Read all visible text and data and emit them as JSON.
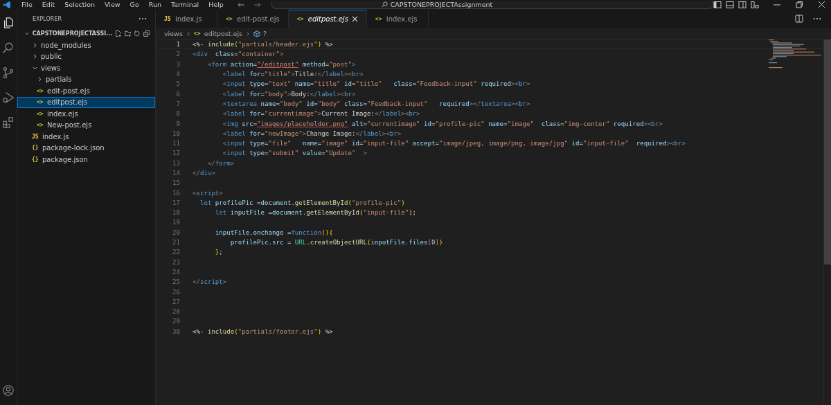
{
  "title_bar": {
    "menu": [
      "File",
      "Edit",
      "Selection",
      "View",
      "Go",
      "Run",
      "Terminal",
      "Help"
    ],
    "search_title": "CAPSTONEPROJECTAssignment"
  },
  "sidebar": {
    "title": "EXPLORER",
    "project": {
      "name": "CAPSTONEPROJECTASSI...",
      "expanded": true
    },
    "tree": [
      {
        "label": "node_modules",
        "kind": "folder",
        "expanded": false,
        "selected": false
      },
      {
        "label": "public",
        "kind": "folder",
        "expanded": false,
        "selected": false
      },
      {
        "label": "views",
        "kind": "folder",
        "expanded": true,
        "selected": false,
        "children": [
          {
            "label": "partials",
            "kind": "folder",
            "expanded": false,
            "selected": false
          },
          {
            "label": "edit-post.ejs",
            "kind": "ejs",
            "icon": "<>",
            "selected": false
          },
          {
            "label": "editpost.ejs",
            "kind": "ejs",
            "icon": "<>",
            "selected": true
          },
          {
            "label": "index.ejs",
            "kind": "ejs",
            "icon": "<>",
            "selected": false
          },
          {
            "label": "New-post.ejs",
            "kind": "ejs",
            "icon": "<>",
            "selected": false
          }
        ]
      },
      {
        "label": "index.js",
        "kind": "js",
        "icon": "JS",
        "selected": false
      },
      {
        "label": "package-lock.json",
        "kind": "json",
        "icon": "{}",
        "selected": false
      },
      {
        "label": "package.json",
        "kind": "json",
        "icon": "{}",
        "selected": false
      }
    ]
  },
  "tabs": [
    {
      "label": "index.js",
      "kind": "js",
      "icon": "JS",
      "selected": false
    },
    {
      "label": "edit-post.ejs",
      "kind": "ejs",
      "icon": "<>",
      "selected": false
    },
    {
      "label": "editpost.ejs",
      "kind": "ejs",
      "icon": "<>",
      "selected": true
    },
    {
      "label": "index.ejs",
      "kind": "ejs",
      "icon": "<>",
      "selected": false
    }
  ],
  "breadcrumb": {
    "parts": [
      "views",
      "editpost.ejs"
    ],
    "symbol": "?"
  },
  "editor": {
    "lines": [
      {
        "number": "1",
        "current": true,
        "tokens": [
          {
            "text": "<%- ",
            "kind": "ejs"
          },
          {
            "text": "include",
            "kind": "fn"
          },
          {
            "text": "(",
            "kind": "paren"
          },
          {
            "text": "\"partials/header.ejs\"",
            "kind": "str"
          },
          {
            "text": ")",
            "kind": "paren"
          },
          {
            "text": " %>",
            "kind": "ejs"
          }
        ]
      },
      {
        "number": "2",
        "current": false,
        "tokens": [
          {
            "text": "<",
            "kind": "br"
          },
          {
            "text": "div",
            "kind": "tag"
          },
          {
            "text": "  class",
            "kind": "attr"
          },
          {
            "text": "=",
            "kind": "text"
          },
          {
            "text": "\"container\"",
            "kind": "str"
          },
          {
            "text": ">",
            "kind": "br"
          }
        ]
      },
      {
        "number": "3",
        "current": false,
        "tokens": [
          {
            "text": "    <",
            "kind": "br"
          },
          {
            "text": "form",
            "kind": "tag"
          },
          {
            "text": " action",
            "kind": "attr"
          },
          {
            "text": "=",
            "kind": "text"
          },
          {
            "text": "\"/editpost\"",
            "kind": "link"
          },
          {
            "text": " method",
            "kind": "attr"
          },
          {
            "text": "=",
            "kind": "text"
          },
          {
            "text": "\"post\"",
            "kind": "str"
          },
          {
            "text": ">",
            "kind": "br"
          }
        ]
      },
      {
        "number": "4",
        "current": false,
        "tokens": [
          {
            "text": "        <",
            "kind": "br"
          },
          {
            "text": "label",
            "kind": "tag"
          },
          {
            "text": " for",
            "kind": "attr"
          },
          {
            "text": "=",
            "kind": "text"
          },
          {
            "text": "\"title\"",
            "kind": "str"
          },
          {
            "text": ">",
            "kind": "br"
          },
          {
            "text": "Title:",
            "kind": "text"
          },
          {
            "text": "</",
            "kind": "br"
          },
          {
            "text": "label",
            "kind": "tag"
          },
          {
            "text": "><",
            "kind": "br"
          },
          {
            "text": "br",
            "kind": "tag"
          },
          {
            "text": ">",
            "kind": "br"
          }
        ]
      },
      {
        "number": "5",
        "current": false,
        "tokens": [
          {
            "text": "        <",
            "kind": "br"
          },
          {
            "text": "input",
            "kind": "tag"
          },
          {
            "text": " type",
            "kind": "attr"
          },
          {
            "text": "=",
            "kind": "text"
          },
          {
            "text": "\"text\"",
            "kind": "str"
          },
          {
            "text": " name",
            "kind": "attr"
          },
          {
            "text": "=",
            "kind": "text"
          },
          {
            "text": "\"title\"",
            "kind": "str"
          },
          {
            "text": " id",
            "kind": "attr"
          },
          {
            "text": "=",
            "kind": "text"
          },
          {
            "text": "\"title\"",
            "kind": "str"
          },
          {
            "text": "   class",
            "kind": "attr"
          },
          {
            "text": "=",
            "kind": "text"
          },
          {
            "text": "\"Feedback-input\"",
            "kind": "str"
          },
          {
            "text": " required",
            "kind": "attr"
          },
          {
            "text": "><",
            "kind": "br"
          },
          {
            "text": "br",
            "kind": "tag"
          },
          {
            "text": ">",
            "kind": "br"
          }
        ]
      },
      {
        "number": "6",
        "current": false,
        "tokens": [
          {
            "text": "        <",
            "kind": "br"
          },
          {
            "text": "label",
            "kind": "tag"
          },
          {
            "text": " for",
            "kind": "attr"
          },
          {
            "text": "=",
            "kind": "text"
          },
          {
            "text": "\"body\"",
            "kind": "str"
          },
          {
            "text": ">",
            "kind": "br"
          },
          {
            "text": "Body:",
            "kind": "text"
          },
          {
            "text": "</",
            "kind": "br"
          },
          {
            "text": "label",
            "kind": "tag"
          },
          {
            "text": "><",
            "kind": "br"
          },
          {
            "text": "br",
            "kind": "tag"
          },
          {
            "text": ">",
            "kind": "br"
          }
        ]
      },
      {
        "number": "7",
        "current": false,
        "tokens": [
          {
            "text": "        <",
            "kind": "br"
          },
          {
            "text": "textarea",
            "kind": "tag"
          },
          {
            "text": " name",
            "kind": "attr"
          },
          {
            "text": "=",
            "kind": "text"
          },
          {
            "text": "\"body\"",
            "kind": "str"
          },
          {
            "text": " id",
            "kind": "attr"
          },
          {
            "text": "=",
            "kind": "text"
          },
          {
            "text": "\"body\"",
            "kind": "str"
          },
          {
            "text": " class",
            "kind": "attr"
          },
          {
            "text": "=",
            "kind": "text"
          },
          {
            "text": "\"Feedback-input\"",
            "kind": "str"
          },
          {
            "text": "   required",
            "kind": "attr"
          },
          {
            "text": "></",
            "kind": "br"
          },
          {
            "text": "textarea",
            "kind": "tag"
          },
          {
            "text": "><",
            "kind": "br"
          },
          {
            "text": "br",
            "kind": "tag"
          },
          {
            "text": ">",
            "kind": "br"
          }
        ]
      },
      {
        "number": "8",
        "current": false,
        "tokens": [
          {
            "text": "        <",
            "kind": "br"
          },
          {
            "text": "label",
            "kind": "tag"
          },
          {
            "text": " for",
            "kind": "attr"
          },
          {
            "text": "=",
            "kind": "text"
          },
          {
            "text": "\"currentimage\"",
            "kind": "str"
          },
          {
            "text": ">",
            "kind": "br"
          },
          {
            "text": "Current Image:",
            "kind": "text"
          },
          {
            "text": "</",
            "kind": "br"
          },
          {
            "text": "label",
            "kind": "tag"
          },
          {
            "text": "><",
            "kind": "br"
          },
          {
            "text": "br",
            "kind": "tag"
          },
          {
            "text": ">",
            "kind": "br"
          }
        ]
      },
      {
        "number": "9",
        "current": false,
        "tokens": [
          {
            "text": "        <",
            "kind": "br"
          },
          {
            "text": "img",
            "kind": "tag"
          },
          {
            "text": " src",
            "kind": "attr"
          },
          {
            "text": "=",
            "kind": "text"
          },
          {
            "text": "\"images/placeholder.png\"",
            "kind": "link"
          },
          {
            "text": " alt",
            "kind": "attr"
          },
          {
            "text": "=",
            "kind": "text"
          },
          {
            "text": "\"currentimage\"",
            "kind": "str"
          },
          {
            "text": " id",
            "kind": "attr"
          },
          {
            "text": "=",
            "kind": "text"
          },
          {
            "text": "\"profile-pic\"",
            "kind": "str"
          },
          {
            "text": " name",
            "kind": "attr"
          },
          {
            "text": "=",
            "kind": "text"
          },
          {
            "text": "\"image\"",
            "kind": "str"
          },
          {
            "text": "  class",
            "kind": "attr"
          },
          {
            "text": "=",
            "kind": "text"
          },
          {
            "text": "\"img-center\"",
            "kind": "str"
          },
          {
            "text": " required",
            "kind": "attr"
          },
          {
            "text": "><",
            "kind": "br"
          },
          {
            "text": "br",
            "kind": "tag"
          },
          {
            "text": ">",
            "kind": "br"
          }
        ]
      },
      {
        "number": "10",
        "current": false,
        "tokens": [
          {
            "text": "        <",
            "kind": "br"
          },
          {
            "text": "label",
            "kind": "tag"
          },
          {
            "text": " for",
            "kind": "attr"
          },
          {
            "text": "=",
            "kind": "text"
          },
          {
            "text": "\"newImage\"",
            "kind": "str"
          },
          {
            "text": ">",
            "kind": "br"
          },
          {
            "text": "Change Image:",
            "kind": "text"
          },
          {
            "text": "</",
            "kind": "br"
          },
          {
            "text": "label",
            "kind": "tag"
          },
          {
            "text": "><",
            "kind": "br"
          },
          {
            "text": "br",
            "kind": "tag"
          },
          {
            "text": ">",
            "kind": "br"
          }
        ]
      },
      {
        "number": "11",
        "current": false,
        "tokens": [
          {
            "text": "        <",
            "kind": "br"
          },
          {
            "text": "input",
            "kind": "tag"
          },
          {
            "text": " type",
            "kind": "attr"
          },
          {
            "text": "=",
            "kind": "text"
          },
          {
            "text": "\"file\"",
            "kind": "str"
          },
          {
            "text": "   name",
            "kind": "attr"
          },
          {
            "text": "=",
            "kind": "text"
          },
          {
            "text": "\"image\"",
            "kind": "str"
          },
          {
            "text": " id",
            "kind": "attr"
          },
          {
            "text": "=",
            "kind": "text"
          },
          {
            "text": "\"input-file\"",
            "kind": "str"
          },
          {
            "text": " accept",
            "kind": "attr"
          },
          {
            "text": "=",
            "kind": "text"
          },
          {
            "text": "\"image/jpeg, image/png, image/jpg\"",
            "kind": "str"
          },
          {
            "text": " id",
            "kind": "attr"
          },
          {
            "text": "=",
            "kind": "text"
          },
          {
            "text": "\"input-file\"",
            "kind": "str"
          },
          {
            "text": "  required",
            "kind": "attr"
          },
          {
            "text": "><",
            "kind": "br"
          },
          {
            "text": "br",
            "kind": "tag"
          },
          {
            "text": ">",
            "kind": "br"
          }
        ]
      },
      {
        "number": "12",
        "current": false,
        "tokens": [
          {
            "text": "        <",
            "kind": "br"
          },
          {
            "text": "input",
            "kind": "tag"
          },
          {
            "text": " type",
            "kind": "attr"
          },
          {
            "text": "=",
            "kind": "text"
          },
          {
            "text": "\"submit\"",
            "kind": "str"
          },
          {
            "text": " value",
            "kind": "attr"
          },
          {
            "text": "=",
            "kind": "text"
          },
          {
            "text": "\"Update\"",
            "kind": "str"
          },
          {
            "text": "  >",
            "kind": "br"
          }
        ]
      },
      {
        "number": "13",
        "current": false,
        "tokens": [
          {
            "text": "    </",
            "kind": "br"
          },
          {
            "text": "form",
            "kind": "tag"
          },
          {
            "text": ">",
            "kind": "br"
          }
        ]
      },
      {
        "number": "14",
        "current": false,
        "tokens": [
          {
            "text": "</",
            "kind": "br"
          },
          {
            "text": "div",
            "kind": "tag"
          },
          {
            "text": ">",
            "kind": "br"
          }
        ]
      },
      {
        "number": "15",
        "current": false
      },
      {
        "number": "16",
        "current": false,
        "tokens": [
          {
            "text": "<",
            "kind": "br"
          },
          {
            "text": "script",
            "kind": "tag"
          },
          {
            "text": ">",
            "kind": "br"
          }
        ]
      },
      {
        "number": "17",
        "current": false,
        "tokens": [
          {
            "text": "  let",
            "kind": "kw"
          },
          {
            "text": " profilePic",
            "kind": "var"
          },
          {
            "text": " =",
            "kind": "text"
          },
          {
            "text": "document",
            "kind": "var"
          },
          {
            "text": ".",
            "kind": "text"
          },
          {
            "text": "getElementById",
            "kind": "fn"
          },
          {
            "text": "(",
            "kind": "paren"
          },
          {
            "text": "\"profile-pic\"",
            "kind": "str"
          },
          {
            "text": ")",
            "kind": "paren"
          }
        ]
      },
      {
        "number": "18",
        "current": false,
        "tokens": [
          {
            "text": "      let",
            "kind": "kw"
          },
          {
            "text": " inputFile",
            "kind": "var"
          },
          {
            "text": " =",
            "kind": "text"
          },
          {
            "text": "document",
            "kind": "var"
          },
          {
            "text": ".",
            "kind": "text"
          },
          {
            "text": "getElementById",
            "kind": "fn"
          },
          {
            "text": "(",
            "kind": "paren"
          },
          {
            "text": "\"input-file\"",
            "kind": "str"
          },
          {
            "text": ")",
            "kind": "paren"
          },
          {
            "text": ";",
            "kind": "text"
          }
        ]
      },
      {
        "number": "19",
        "current": false
      },
      {
        "number": "20",
        "current": false,
        "tokens": [
          {
            "text": "      inputFile",
            "kind": "var"
          },
          {
            "text": ".",
            "kind": "text"
          },
          {
            "text": "onchange",
            "kind": "var"
          },
          {
            "text": " =",
            "kind": "text"
          },
          {
            "text": "function",
            "kind": "kw"
          },
          {
            "text": "(){",
            "kind": "paren"
          }
        ]
      },
      {
        "number": "21",
        "current": false,
        "tokens": [
          {
            "text": "          profilePic",
            "kind": "var"
          },
          {
            "text": ".",
            "kind": "text"
          },
          {
            "text": "src",
            "kind": "var"
          },
          {
            "text": " = ",
            "kind": "text"
          },
          {
            "text": "URL",
            "kind": "class"
          },
          {
            "text": ".",
            "kind": "text"
          },
          {
            "text": "createObjectURL",
            "kind": "fn"
          },
          {
            "text": "(",
            "kind": "paren"
          },
          {
            "text": "inputFile",
            "kind": "var"
          },
          {
            "text": ".",
            "kind": "text"
          },
          {
            "text": "files",
            "kind": "var"
          },
          {
            "text": "[",
            "kind": "paren2"
          },
          {
            "text": "0",
            "kind": "num"
          },
          {
            "text": "]",
            "kind": "paren2"
          },
          {
            "text": ")",
            "kind": "paren"
          }
        ]
      },
      {
        "number": "22",
        "current": false,
        "tokens": [
          {
            "text": "      }",
            "kind": "paren"
          },
          {
            "text": ";",
            "kind": "text"
          }
        ]
      },
      {
        "number": "23",
        "current": false
      },
      {
        "number": "24",
        "current": false
      },
      {
        "number": "25",
        "current": false,
        "tokens": [
          {
            "text": "</",
            "kind": "br"
          },
          {
            "text": "script",
            "kind": "tag"
          },
          {
            "text": ">",
            "kind": "br"
          }
        ]
      },
      {
        "number": "26",
        "current": false
      },
      {
        "number": "27",
        "current": false
      },
      {
        "number": "28",
        "current": false
      },
      {
        "number": "29",
        "current": false
      },
      {
        "number": "30",
        "current": false,
        "tokens": [
          {
            "text": "<%- ",
            "kind": "ejs"
          },
          {
            "text": "include",
            "kind": "fn"
          },
          {
            "text": "(",
            "kind": "paren"
          },
          {
            "text": "\"partials/footer.ejs\"",
            "kind": "str"
          },
          {
            "text": ")",
            "kind": "paren"
          },
          {
            "text": " %>",
            "kind": "ejs"
          }
        ]
      }
    ]
  }
}
